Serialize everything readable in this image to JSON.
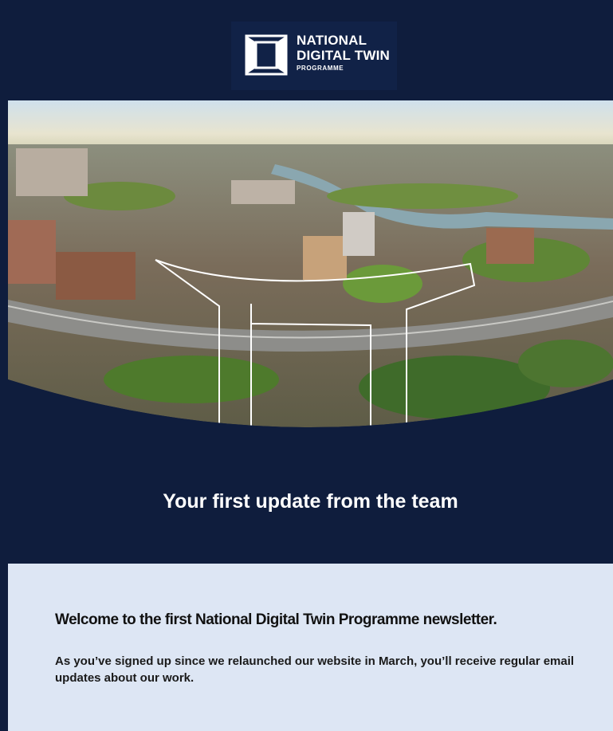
{
  "header": {
    "logo": {
      "line1": "NATIONAL",
      "line2": "DIGITAL TWIN",
      "line3": "PROGRAMME",
      "icon": "frame-icon"
    }
  },
  "hero": {
    "image": "aerial-city-photo"
  },
  "headline": "Your first update from the team",
  "content": {
    "welcome": "Welcome to the first National Digital Twin Programme newsletter.",
    "body": "As you’ve signed up since we relaunched our website in March, you’ll receive regular email updates about our work."
  },
  "colors": {
    "navy": "#0f1d3d",
    "panel": "#dde6f4"
  }
}
